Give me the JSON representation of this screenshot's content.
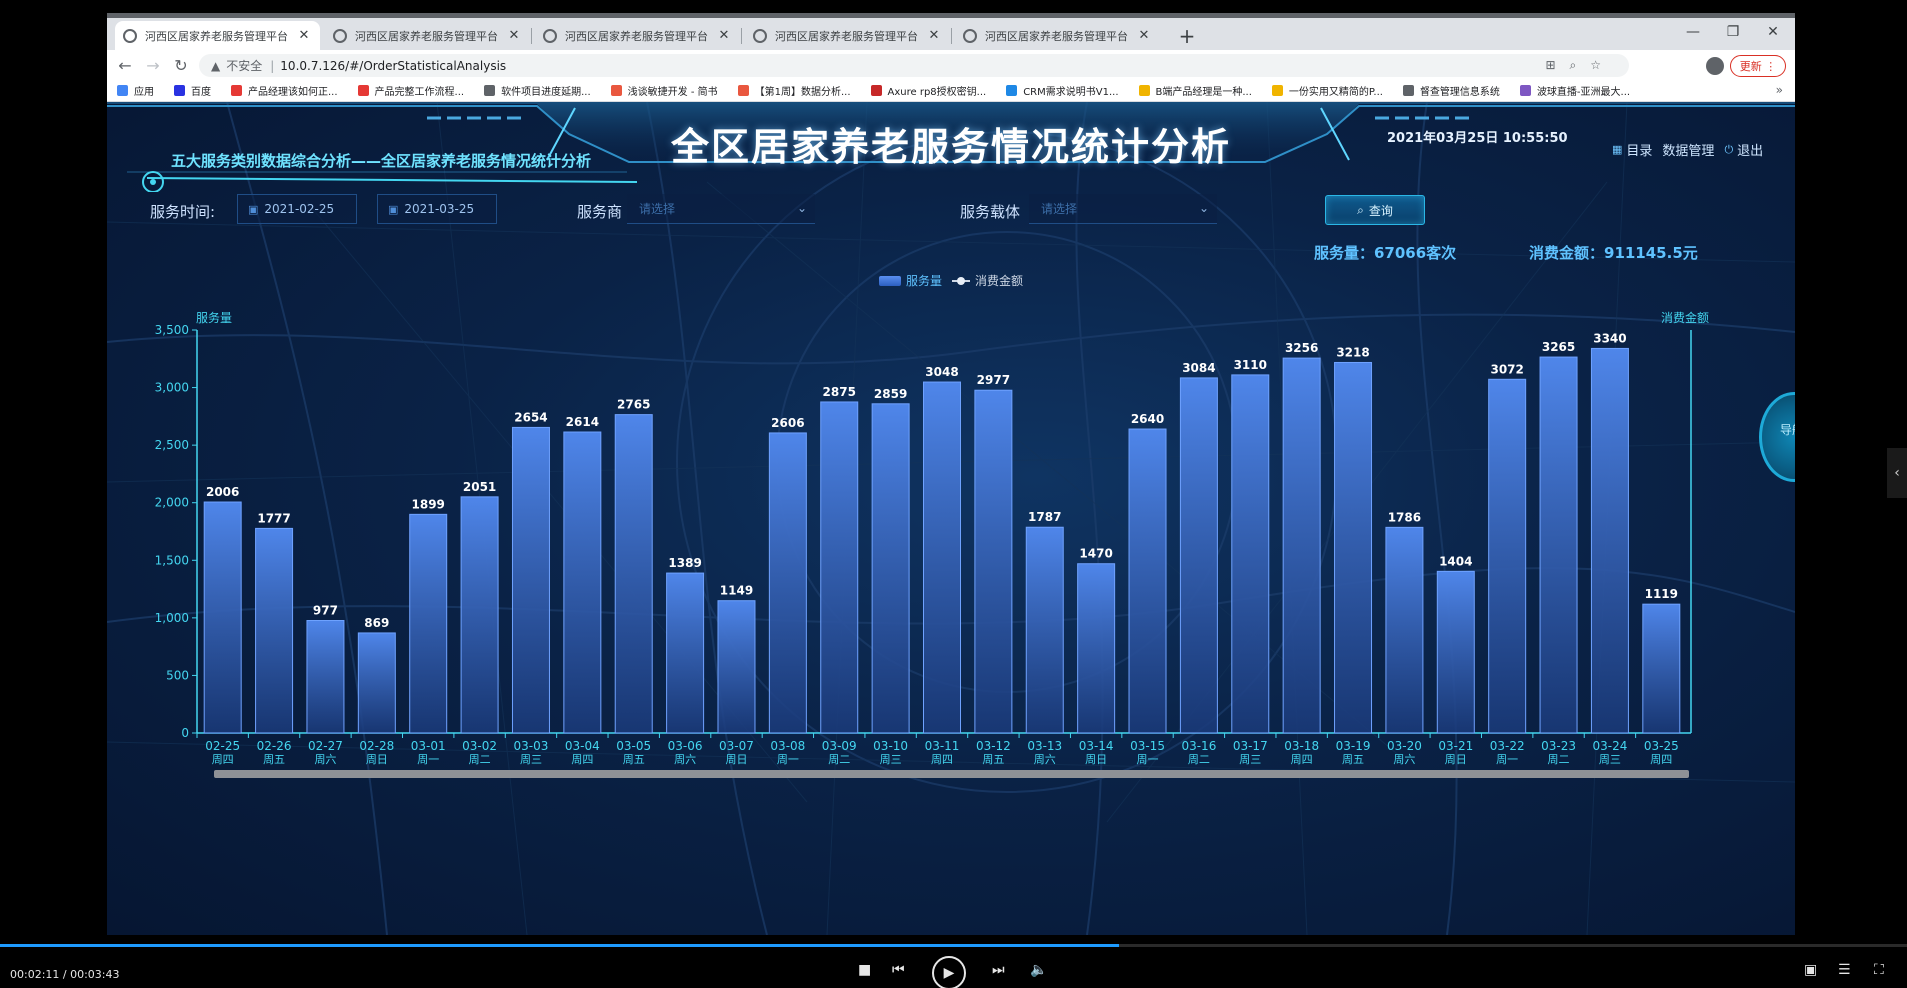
{
  "browser": {
    "tabs": [
      {
        "title": "河西区居家养老服务管理平台",
        "active": true
      },
      {
        "title": "河西区居家养老服务管理平台",
        "active": false
      },
      {
        "title": "河西区居家养老服务管理平台",
        "active": false
      },
      {
        "title": "河西区居家养老服务管理平台",
        "active": false
      },
      {
        "title": "河西区居家养老服务管理平台",
        "active": false
      }
    ],
    "insecure_label": "不安全",
    "url": "10.0.7.126/#/OrderStatisticalAnalysis",
    "update_label": "更新",
    "bookmarks": [
      {
        "label": "应用",
        "color": "#4285f4"
      },
      {
        "label": "百度",
        "color": "#2932e1"
      },
      {
        "label": "产品经理该如何正...",
        "color": "#e53935"
      },
      {
        "label": "产品完整工作流程...",
        "color": "#e53935"
      },
      {
        "label": "软件项目进度延期...",
        "color": "#5f6368"
      },
      {
        "label": "浅谈敏捷开发 - 简书",
        "color": "#e9573f"
      },
      {
        "label": "【第1周】数据分析...",
        "color": "#e9573f"
      },
      {
        "label": "Axure rp8授权密钥...",
        "color": "#c62828"
      },
      {
        "label": "CRM需求说明书V1...",
        "color": "#1e88e5"
      },
      {
        "label": "B端产品经理是一种...",
        "color": "#f0b400"
      },
      {
        "label": "一份实用又精简的P...",
        "color": "#f0b400"
      },
      {
        "label": "督查管理信息系统",
        "color": "#5f6368"
      },
      {
        "label": "波球直播-亚洲最大...",
        "color": "#7e57c2"
      }
    ]
  },
  "dashboard": {
    "title": "全区居家养老服务情况统计分析",
    "subtitle": "五大服务类别数据综合分析——全区居家养老服务情况统计分析",
    "datetime": "2021年03月25日 10:55:50",
    "links": {
      "catalog": "目录",
      "data_mgmt": "数据管理",
      "logout": "退出"
    },
    "filters": {
      "time_label": "服务时间:",
      "start_date": "2021-02-25",
      "end_date": "2021-03-25",
      "provider_label": "服务商",
      "provider_placeholder": "请选择",
      "carrier_label": "服务载体",
      "carrier_placeholder": "请选择",
      "query_label": "查询"
    },
    "stats": {
      "service_count": "服务量：67066客次",
      "amount": "消费金额：911145.5元"
    },
    "side_nav_label": "导航"
  },
  "chart_data": {
    "type": "bar",
    "legend": [
      "服务量",
      "消费金额"
    ],
    "ylabel_left": "服务量",
    "ylabel_right": "消费金额",
    "ylim": [
      0,
      3500
    ],
    "yticks": [
      0,
      500,
      1000,
      1500,
      2000,
      2500,
      3000,
      3500
    ],
    "categories": [
      {
        "date": "02-25",
        "day": "周四"
      },
      {
        "date": "02-26",
        "day": "周五"
      },
      {
        "date": "02-27",
        "day": "周六"
      },
      {
        "date": "02-28",
        "day": "周日"
      },
      {
        "date": "03-01",
        "day": "周一"
      },
      {
        "date": "03-02",
        "day": "周二"
      },
      {
        "date": "03-03",
        "day": "周三"
      },
      {
        "date": "03-04",
        "day": "周四"
      },
      {
        "date": "03-05",
        "day": "周五"
      },
      {
        "date": "03-06",
        "day": "周六"
      },
      {
        "date": "03-07",
        "day": "周日"
      },
      {
        "date": "03-08",
        "day": "周一"
      },
      {
        "date": "03-09",
        "day": "周二"
      },
      {
        "date": "03-10",
        "day": "周三"
      },
      {
        "date": "03-11",
        "day": "周四"
      },
      {
        "date": "03-12",
        "day": "周五"
      },
      {
        "date": "03-13",
        "day": "周六"
      },
      {
        "date": "03-14",
        "day": "周日"
      },
      {
        "date": "03-15",
        "day": "周一"
      },
      {
        "date": "03-16",
        "day": "周二"
      },
      {
        "date": "03-17",
        "day": "周三"
      },
      {
        "date": "03-18",
        "day": "周四"
      },
      {
        "date": "03-19",
        "day": "周五"
      },
      {
        "date": "03-20",
        "day": "周六"
      },
      {
        "date": "03-21",
        "day": "周日"
      },
      {
        "date": "03-22",
        "day": "周一"
      },
      {
        "date": "03-23",
        "day": "周二"
      },
      {
        "date": "03-24",
        "day": "周三"
      },
      {
        "date": "03-25",
        "day": "周四"
      }
    ],
    "series": [
      {
        "name": "服务量",
        "values": [
          2006,
          1777,
          977,
          869,
          1899,
          2051,
          2654,
          2614,
          2765,
          1389,
          1149,
          2606,
          2875,
          2859,
          3048,
          2977,
          1787,
          1470,
          2640,
          3084,
          3110,
          3256,
          3218,
          1786,
          1404,
          3072,
          3265,
          3340,
          1119
        ]
      }
    ],
    "bar_color_top": "#4f86ea",
    "bar_color_bottom": "#1a3a7a",
    "axis_color": "#44d6f0"
  },
  "player": {
    "timecode": "00:02:11 / 00:03:43",
    "progress": 0.587
  }
}
